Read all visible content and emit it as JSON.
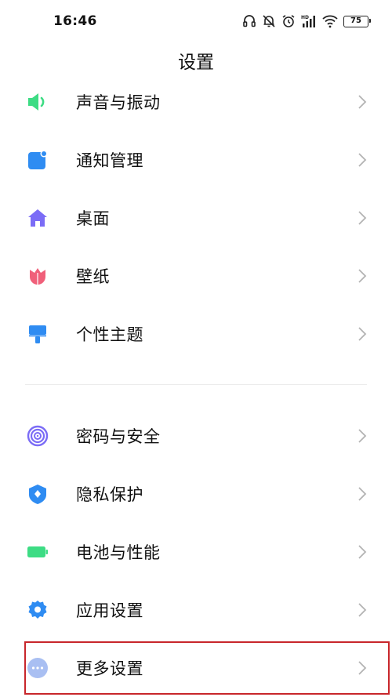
{
  "status_bar": {
    "time": "16:46",
    "battery": "75",
    "icons": [
      "headphones-icon",
      "silent-bell-icon",
      "alarm-icon",
      "hd-signal-icon",
      "wifi-icon",
      "battery-icon"
    ]
  },
  "header": {
    "title": "设置"
  },
  "groups": [
    {
      "items": [
        {
          "label": "声音与振动",
          "icon": "speaker-icon",
          "color": "#3ddc84"
        },
        {
          "label": "通知管理",
          "icon": "notification-icon",
          "color": "#2f8cf2"
        },
        {
          "label": "桌面",
          "icon": "home-icon",
          "color": "#7b6cf6"
        },
        {
          "label": "壁纸",
          "icon": "tulip-icon",
          "color": "#f0607a"
        },
        {
          "label": "个性主题",
          "icon": "paint-brush-icon",
          "color": "#2f8cf2"
        }
      ]
    },
    {
      "items": [
        {
          "label": "密码与安全",
          "icon": "fingerprint-icon",
          "color": "#7b6cf6"
        },
        {
          "label": "隐私保护",
          "icon": "shield-icon",
          "color": "#2f8cf2"
        },
        {
          "label": "电池与性能",
          "icon": "battery-icon",
          "color": "#3ddc84"
        },
        {
          "label": "应用设置",
          "icon": "gear-icon",
          "color": "#2f8cf2"
        },
        {
          "label": "更多设置",
          "icon": "more-icon",
          "color": "#a9bff2"
        }
      ]
    }
  ],
  "highlight_color": "#c8262b"
}
